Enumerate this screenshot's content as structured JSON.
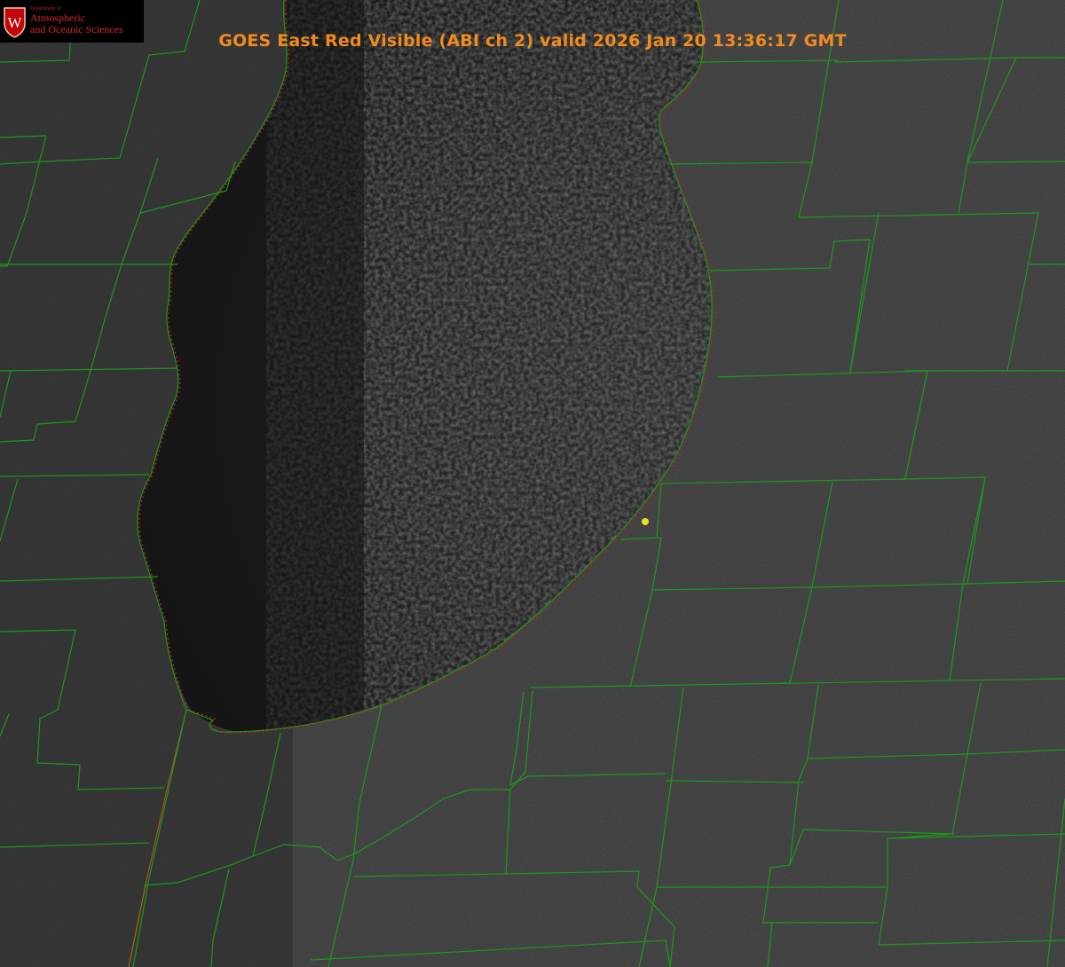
{
  "title": "GOES East Red Visible (ABI ch 2) valid 2026 Jan 20 13:36:17 GMT",
  "logo": {
    "department": "Department of",
    "line1": "Atmospheric",
    "line2": "and Oceanic Sciences",
    "crest_letter": "W"
  },
  "colors": {
    "title": "#f08c1e",
    "boundary": "#1a9a1a",
    "shoreline": "#d01818",
    "marker": "#e8e020",
    "land": "#3a3a3a",
    "lake": "#161616"
  },
  "layers": [
    "county-boundaries",
    "shoreline",
    "station-marker"
  ]
}
